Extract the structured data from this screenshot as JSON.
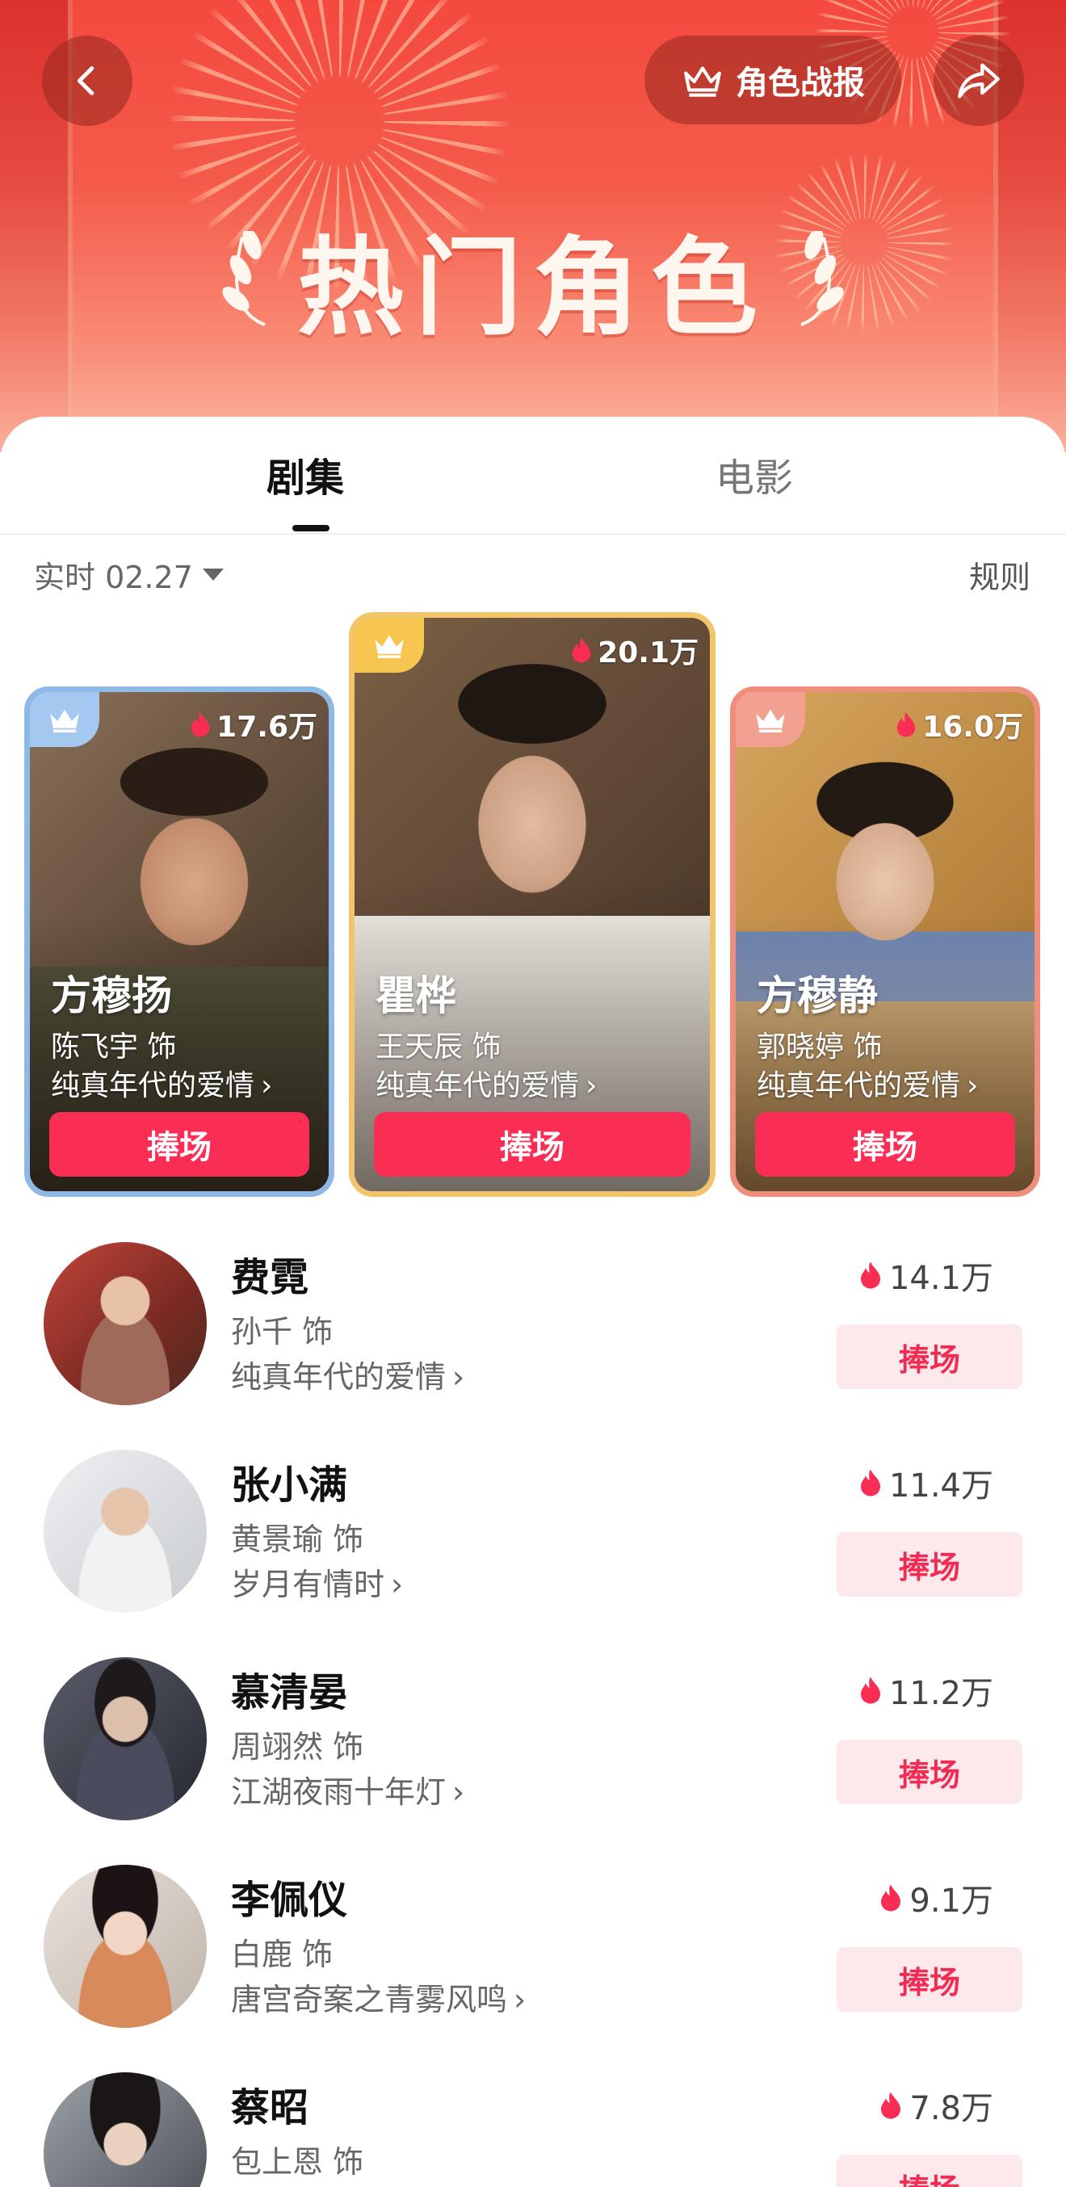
{
  "header": {
    "title": "热门角色",
    "report_label": "角色战报"
  },
  "tabs": [
    {
      "label": "剧集",
      "active": true
    },
    {
      "label": "电影",
      "active": false
    }
  ],
  "filter": {
    "label": "实时 02.27"
  },
  "rules_label": "规则",
  "top3": [
    {
      "rank": 2,
      "heat": "17.6万",
      "name": "方穆扬",
      "actor": "陈飞宇 饰",
      "show": "纯真年代的爱情",
      "button": "捧场",
      "crown_color": "#a5c8f1"
    },
    {
      "rank": 1,
      "heat": "20.1万",
      "name": "瞿桦",
      "actor": "王天辰 饰",
      "show": "纯真年代的爱情",
      "button": "捧场",
      "crown_color": "#f6c651"
    },
    {
      "rank": 3,
      "heat": "16.0万",
      "name": "方穆静",
      "actor": "郭晓婷 饰",
      "show": "纯真年代的爱情",
      "button": "捧场",
      "crown_color": "#f2a090"
    }
  ],
  "list": [
    {
      "name": "费霓",
      "actor": "孙千 饰",
      "show": "纯真年代的爱情",
      "heat": "14.1万",
      "button": "捧场"
    },
    {
      "name": "张小满",
      "actor": "黄景瑜 饰",
      "show": "岁月有情时",
      "heat": "11.4万",
      "button": "捧场"
    },
    {
      "name": "慕清晏",
      "actor": "周翊然 饰",
      "show": "江湖夜雨十年灯",
      "heat": "11.2万",
      "button": "捧场"
    },
    {
      "name": "李佩仪",
      "actor": "白鹿 饰",
      "show": "唐宫奇案之青雾风鸣",
      "heat": "9.1万",
      "button": "捧场"
    },
    {
      "name": "蔡昭",
      "actor": "包上恩 饰",
      "show": "",
      "heat": "7.8万",
      "button": "捧场"
    }
  ],
  "colors": {
    "accent": "#fa2d55",
    "header_red": "#f4493f",
    "gold": "#f2c56b",
    "silver": "#8eb8e6",
    "bronze": "#ef8e7d"
  }
}
